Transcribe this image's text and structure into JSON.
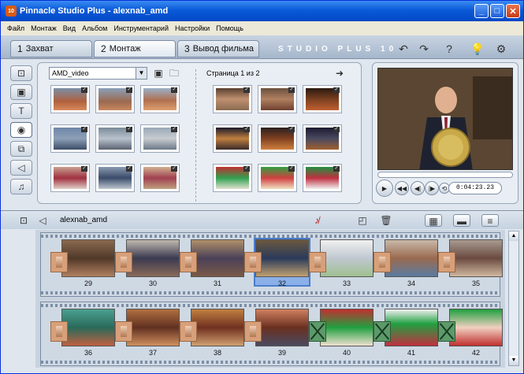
{
  "window": {
    "title": "Pinnacle Studio Plus - alexnab_amd",
    "app_icon_text": "10",
    "min": "_",
    "max": "□",
    "close": "✕"
  },
  "menu": [
    "Файл",
    "Монтаж",
    "Вид",
    "Альбом",
    "Инструментарий",
    "Настройки",
    "Помощь"
  ],
  "modes": [
    {
      "num": "1",
      "label": "Захват"
    },
    {
      "num": "2",
      "label": "Монтаж"
    },
    {
      "num": "3",
      "label": "Вывод фильма"
    }
  ],
  "brand": "STUDIO PLUS 10",
  "top_icons": {
    "undo": "↶",
    "redo": "↷",
    "help": "?",
    "tip": "💡",
    "settings": "⚙"
  },
  "left_tabs": [
    "⊡",
    "▣",
    "T",
    "◉",
    "⧉",
    "◁",
    "♫"
  ],
  "album": {
    "select_value": "AMD_video",
    "page_label": "Страница 1 из 2",
    "dd": "▼",
    "folder1": "▣",
    "folder2": "🗀",
    "next": "➜"
  },
  "album_left_thumbs": [
    {
      "g": "linear-gradient(#7b8fa8,#b0603c 60%,#d88a5c)"
    },
    {
      "g": "linear-gradient(#8aa0b8,#9a6a50 60%,#c88860)"
    },
    {
      "g": "linear-gradient(#9ab0c8,#b07050 55%,#e0a070)"
    },
    {
      "g": "linear-gradient(#6f86a8,#8ca0b6 50%,#3c4d68)"
    },
    {
      "g": "linear-gradient(#7a8a9a,#b8c2cc 50%,#5a6270)"
    },
    {
      "g": "linear-gradient(#9aa8b8,#c8ccd0 50%,#6a7888)"
    },
    {
      "g": "linear-gradient(#c8a090,#a03040 50%,#e0d0c8)"
    },
    {
      "g": "linear-gradient(#8a9ab0,#3a4a6a 50%,#c0c8d0)"
    },
    {
      "g": "linear-gradient(#d0b090,#a04050 50%,#c0a080)"
    }
  ],
  "album_right_thumbs": [
    {
      "g": "linear-gradient(#5a4030,#c09070 50%,#8a6a50)"
    },
    {
      "g": "linear-gradient(#6a5040,#b08060 50%,#704030)"
    },
    {
      "g": "linear-gradient(#2a1a10,#7a4020 50%,#c06030)"
    },
    {
      "g": "linear-gradient(#1a1a2a,#c08040 50%,#3a2a2a)"
    },
    {
      "g": "linear-gradient(#2a2020,#804020 50%,#d08040)"
    },
    {
      "g": "linear-gradient(#1a1a30,#4a4a60 50%,#a06030)"
    },
    {
      "g": "linear-gradient(#c03030,#30a050 50%,#e0e0d0)"
    },
    {
      "g": "linear-gradient(#30a040,#d04040 50%,#f0e0c0)"
    },
    {
      "g": "linear-gradient(#209040,#c03040 50%,#f0f0f0)"
    }
  ],
  "player": {
    "timecode": "0:04:23.23",
    "play": "▶",
    "rew": "◀◀",
    "prev": "◀|",
    "next": "|▶",
    "loop": "⟲"
  },
  "timeline": {
    "project_name": "alexnab_amd",
    "view1": "◰",
    "view2": "◱",
    "mute": "♪̸",
    "trash": "🗑",
    "sb_view": "▦",
    "tl_view": "▬",
    "text_view": "≡",
    "cam": "⊡",
    "audio": "◁"
  },
  "clips_row1": [
    {
      "n": "29",
      "g": "linear-gradient(#8a6a50,#503828 50%,#b08060)"
    },
    {
      "n": "30",
      "g": "linear-gradient(#c0b8b0,#3a3a50 50%,#8a6a5a)"
    },
    {
      "n": "31",
      "g": "linear-gradient(#b0906a,#4a4058 50%,#7a5a48)"
    },
    {
      "n": "32",
      "g": "linear-gradient(#6a5840,#2a3a5a 50%,#c0a070)",
      "sel": true
    },
    {
      "n": "33",
      "g": "linear-gradient(#f0f0f0,#c0c8d0 50%,#a0c090)"
    },
    {
      "n": "34",
      "g": "linear-gradient(#c8b8a8,#9a6a50 50%,#5a7aa0)"
    },
    {
      "n": "35",
      "g": "linear-gradient(#a89a90,#6a4a40 50%,#d0b8a0)"
    }
  ],
  "clips_row2": [
    {
      "n": "36",
      "g": "linear-gradient(#4aa090,#2a6a5a 50%,#c06040)"
    },
    {
      "n": "37",
      "g": "linear-gradient(#b07040,#603020 50%,#d09060)"
    },
    {
      "n": "38",
      "g": "linear-gradient(#c08040,#703020 50%,#d0a070)"
    },
    {
      "n": "39",
      "g": "linear-gradient(#d08060,#6a3020 50%,#4a4a60)"
    },
    {
      "n": "40",
      "g": "linear-gradient(#c03030,#20a040 50%,#f0e0d0)"
    },
    {
      "n": "41",
      "g": "linear-gradient(#f0f0f0,#20a040 40%,#c03040)"
    },
    {
      "n": "42",
      "g": "linear-gradient(#20a040,#f0d0c0 50%,#c03030)"
    }
  ],
  "scroll": {
    "up": "▲",
    "down": "▼"
  }
}
